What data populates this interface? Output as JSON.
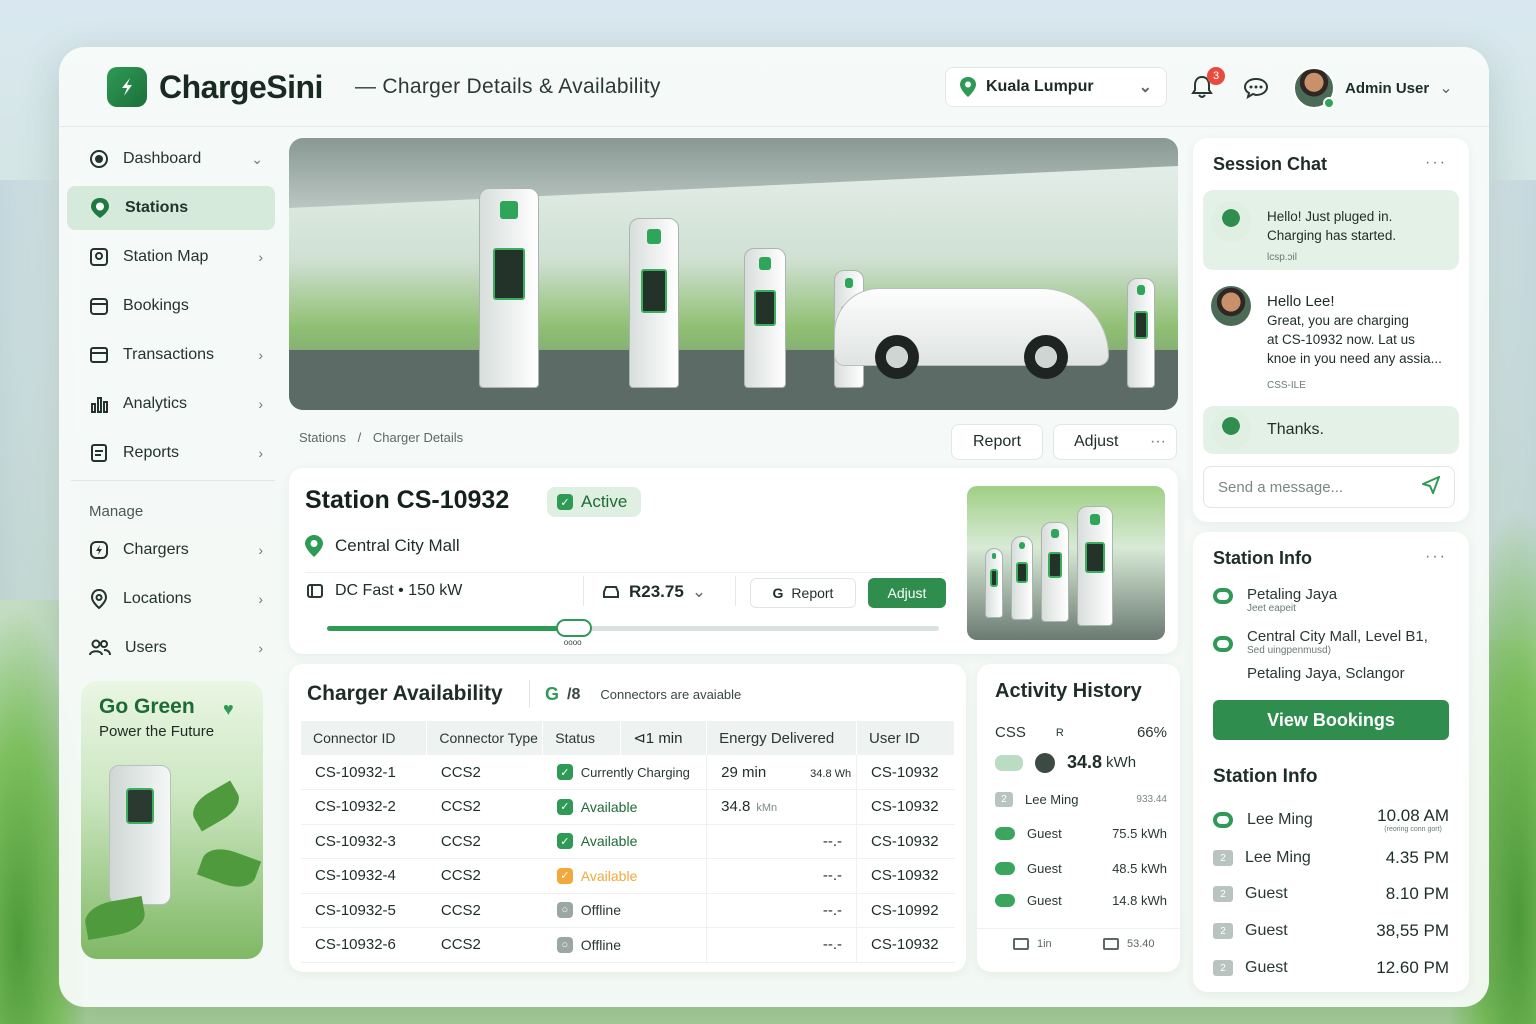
{
  "app": {
    "name": "ChargeSini",
    "page_title": "—  Charger Details & Availability"
  },
  "header": {
    "location": "Kuala Lumpur",
    "notifications": "3",
    "user": "Admin User"
  },
  "sidebar": {
    "items": [
      {
        "label": "Dashboard",
        "icon": "dashboard-icon"
      },
      {
        "label": "Stations",
        "icon": "station-pin-icon"
      },
      {
        "label": "Station Map",
        "icon": "map-icon"
      },
      {
        "label": "Bookings",
        "icon": "calendar-icon"
      },
      {
        "label": "Transactions",
        "icon": "transactions-icon"
      },
      {
        "label": "Analytics",
        "icon": "bar-chart-icon"
      },
      {
        "label": "Reports",
        "icon": "report-icon"
      }
    ],
    "manage_title": "Manage",
    "manage_items": [
      {
        "label": "Chargers",
        "icon": "charger-icon"
      },
      {
        "label": "Locations",
        "icon": "location-icon"
      },
      {
        "label": "Users",
        "icon": "users-icon"
      }
    ],
    "promo": {
      "title": "Go Green",
      "subtitle": "Power the Future"
    }
  },
  "breadcrumb": {
    "root": "Stations",
    "sep": "/",
    "current": "Charger Details"
  },
  "actions": {
    "report": "Report",
    "adjust": "Adjust",
    "more": "···"
  },
  "station": {
    "title": "Station CS-10932",
    "status": "Active",
    "location": "Central City Mall",
    "type": "DC Fast • 150 kW",
    "price": "R23.75",
    "report": "Report",
    "adjust": "Adjust",
    "slider_level": 0.4,
    "slider_caption": "oooo"
  },
  "availability": {
    "title": "Charger Availability",
    "connectors_note": "Connectors are avaiable",
    "connectors_icon": "/8",
    "columns": [
      "Connector ID",
      "Connector Type",
      "Status",
      "⊲1 min",
      "Energy Delivered",
      "User ID"
    ],
    "rows": [
      {
        "id": "CS-10932-1",
        "type": "CCS2",
        "status": "Currently Charging",
        "kind": "ok",
        "time": "29 min",
        "energy": "34.8 Wh",
        "user": "CS-10932"
      },
      {
        "id": "CS-10932-2",
        "type": "CCS2",
        "status": "Available",
        "kind": "ok",
        "time": "34.8",
        "energy": "kMn",
        "user": "CS-10932"
      },
      {
        "id": "CS-10932-3",
        "type": "CCS2",
        "status": "Available",
        "kind": "ok",
        "time": "",
        "energy": "--.-",
        "user": "CS-10932"
      },
      {
        "id": "CS-10932-4",
        "type": "CCS2",
        "status": "Available",
        "kind": "warn",
        "time": "",
        "energy": "--.-",
        "user": "CS-10932"
      },
      {
        "id": "CS-10932-5",
        "type": "CCS2",
        "status": "Offline",
        "kind": "off",
        "time": "",
        "energy": "--.-",
        "user": "CS-10992"
      },
      {
        "id": "CS-10932-6",
        "type": "CCS2",
        "status": "Offline",
        "kind": "off",
        "time": "",
        "energy": "--.-",
        "user": "CS-10932"
      }
    ]
  },
  "activity": {
    "title": "Activity History",
    "head_left": "CSS",
    "head_mid": "R",
    "head_right": "66%",
    "total": "34.8",
    "total_unit": "kWh",
    "rows": [
      {
        "name": "Lee Ming",
        "value": "933.44",
        "badge": "2"
      },
      {
        "name": "Guest",
        "value": "75.5 kWh"
      },
      {
        "name": "Guest",
        "value": "48.5 kWh"
      },
      {
        "name": "Guest",
        "value": "14.8 kWh"
      }
    ],
    "foot_left": "1in",
    "foot_right": "53.40"
  },
  "chat": {
    "title": "Session Chat",
    "messages": [
      {
        "text1": "Hello! Just pluged in.",
        "text2": "Charging has started.",
        "time": "lcsp.ɔil"
      },
      {
        "text1": "Hello Lee!",
        "text2": "Great, you are charging",
        "text3": "at CS-10932 now. Lat us",
        "text4": "knoe in you need any assia...",
        "time": "CSS-ILE"
      },
      {
        "text1": "Thanks."
      }
    ],
    "placeholder": "Send a message..."
  },
  "station_info": {
    "title": "Station Info",
    "city": "Petaling Jaya",
    "city_sub": "Jeet eapeit",
    "addr": "Central City Mall, Level B1,",
    "addr_sub": "Sed uingpenmusd)",
    "region": "Petaling Jaya, Sclangor",
    "button": "View Bookings"
  },
  "station_info2": {
    "title": "Station Info",
    "rows": [
      {
        "name": "Lee Ming",
        "time": "10.08 AM",
        "sub": "(reoring conn gort)"
      },
      {
        "name": "Lee Ming",
        "time": "4.35 PM",
        "badge": "2"
      },
      {
        "name": "Guest",
        "time": "8.10 PM",
        "badge": "2"
      },
      {
        "name": "Guest",
        "time": "38,55 PM",
        "badge": "2"
      },
      {
        "name": "Guest",
        "time": "12.60 PM",
        "badge": "2"
      }
    ]
  },
  "colors": {
    "brand": "#2f9a55",
    "warn": "#f2a93b",
    "offline": "#9aa7a2"
  }
}
